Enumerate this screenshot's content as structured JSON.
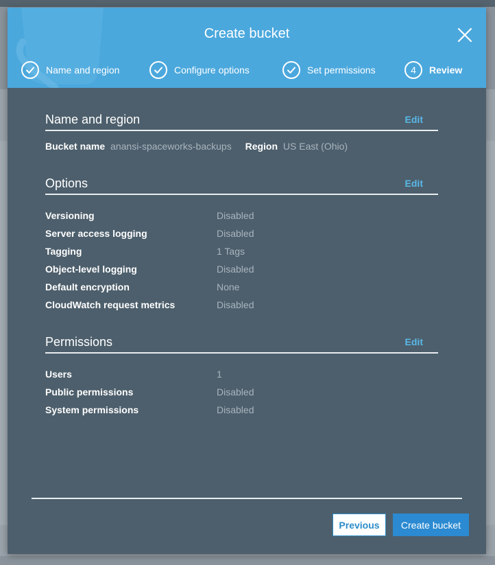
{
  "modal": {
    "title": "Create bucket"
  },
  "steps": [
    {
      "label": "Name and region",
      "status": "complete"
    },
    {
      "label": "Configure options",
      "status": "complete"
    },
    {
      "label": "Set permissions",
      "status": "complete"
    },
    {
      "label": "Review",
      "number": "4",
      "status": "active"
    }
  ],
  "sections": {
    "name_region": {
      "title": "Name and region",
      "edit_label": "Edit",
      "bucket_name_label": "Bucket name",
      "bucket_name_value": "anansi-spaceworks-backups",
      "region_label": "Region",
      "region_value": "US East (Ohio)"
    },
    "options": {
      "title": "Options",
      "edit_label": "Edit",
      "rows": [
        {
          "label": "Versioning",
          "value": "Disabled"
        },
        {
          "label": "Server access logging",
          "value": "Disabled"
        },
        {
          "label": "Tagging",
          "value": "1 Tags"
        },
        {
          "label": "Object-level logging",
          "value": "Disabled"
        },
        {
          "label": "Default encryption",
          "value": "None"
        },
        {
          "label": "CloudWatch request metrics",
          "value": "Disabled"
        }
      ]
    },
    "permissions": {
      "title": "Permissions",
      "edit_label": "Edit",
      "rows": [
        {
          "label": "Users",
          "value": "1"
        },
        {
          "label": "Public permissions",
          "value": "Disabled"
        },
        {
          "label": "System permissions",
          "value": "Disabled"
        }
      ]
    }
  },
  "footer": {
    "previous_label": "Previous",
    "create_label": "Create bucket"
  },
  "colors": {
    "header": "#4ba8dd",
    "modal_body": "#4d5f6c",
    "link": "#5ab8e8",
    "primary_button": "#2b8ad1"
  },
  "icons": {
    "step_complete": "check-circle-icon",
    "close": "close-icon"
  }
}
